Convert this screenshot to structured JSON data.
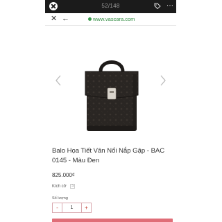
{
  "viewer": {
    "counter": "52/148",
    "icons": [
      "close-icon",
      "tag-icon",
      "more-icon"
    ]
  },
  "browser": {
    "close_label": "✕",
    "back_label": "←",
    "url": "www.vascara.com"
  },
  "product": {
    "title": "Balo Họa Tiết Vân Nổi Nắp Gập - BAC 0145 - Màu Đen",
    "price": "825.000₫",
    "size_label": "Kích cỡ",
    "size_value": "S",
    "quantity_label": "Số lượng",
    "quantity_value": "1",
    "minus_label": "-",
    "plus_label": "+"
  },
  "colors": {
    "accent": "#e06e78",
    "url_green": "#2e8b3f",
    "bag": "#2a2623"
  }
}
